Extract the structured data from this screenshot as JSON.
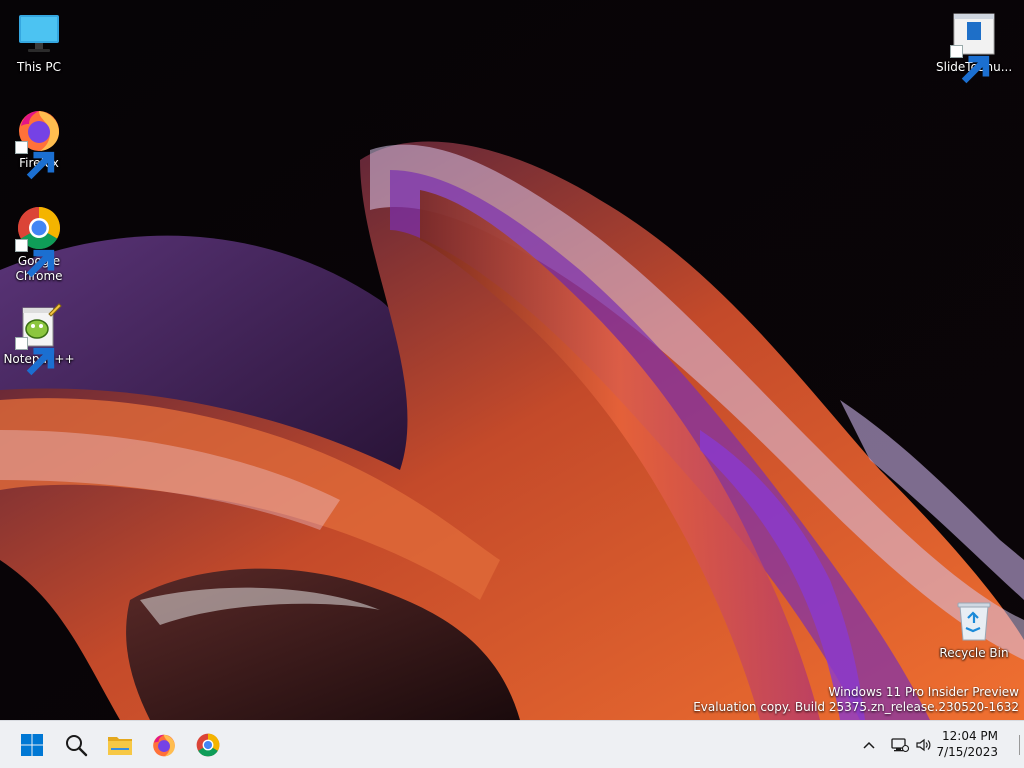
{
  "desktop": {
    "icons_left": [
      {
        "label": "This PC",
        "icon": "computer-icon",
        "shortcut": false
      },
      {
        "label": "Firefox",
        "icon": "firefox-icon",
        "shortcut": true
      },
      {
        "label": "Google Chrome",
        "icon": "chrome-icon",
        "shortcut": true
      },
      {
        "label": "Notepad++",
        "icon": "notepadpp-icon",
        "shortcut": true
      }
    ],
    "icons_right": [
      {
        "label": "SlideToShu...",
        "icon": "slidetoshutdown-icon",
        "shortcut": true
      },
      {
        "label": "Recycle Bin",
        "icon": "recycle-bin-icon",
        "shortcut": false
      }
    ],
    "watermark": {
      "line1": "Windows 11 Pro Insider Preview",
      "line2": "Evaluation copy. Build 25375.zn_release.230520-1632"
    }
  },
  "taskbar": {
    "background": "#eef0f3",
    "apps": [
      "start-icon",
      "search-icon",
      "file-explorer-icon",
      "firefox-icon",
      "chrome-icon"
    ],
    "tray": {
      "time": "12:04 PM",
      "date": "7/15/2023"
    }
  },
  "colors": {
    "start_blue": "#0078d4",
    "folder_yellow": "#f7c845"
  }
}
